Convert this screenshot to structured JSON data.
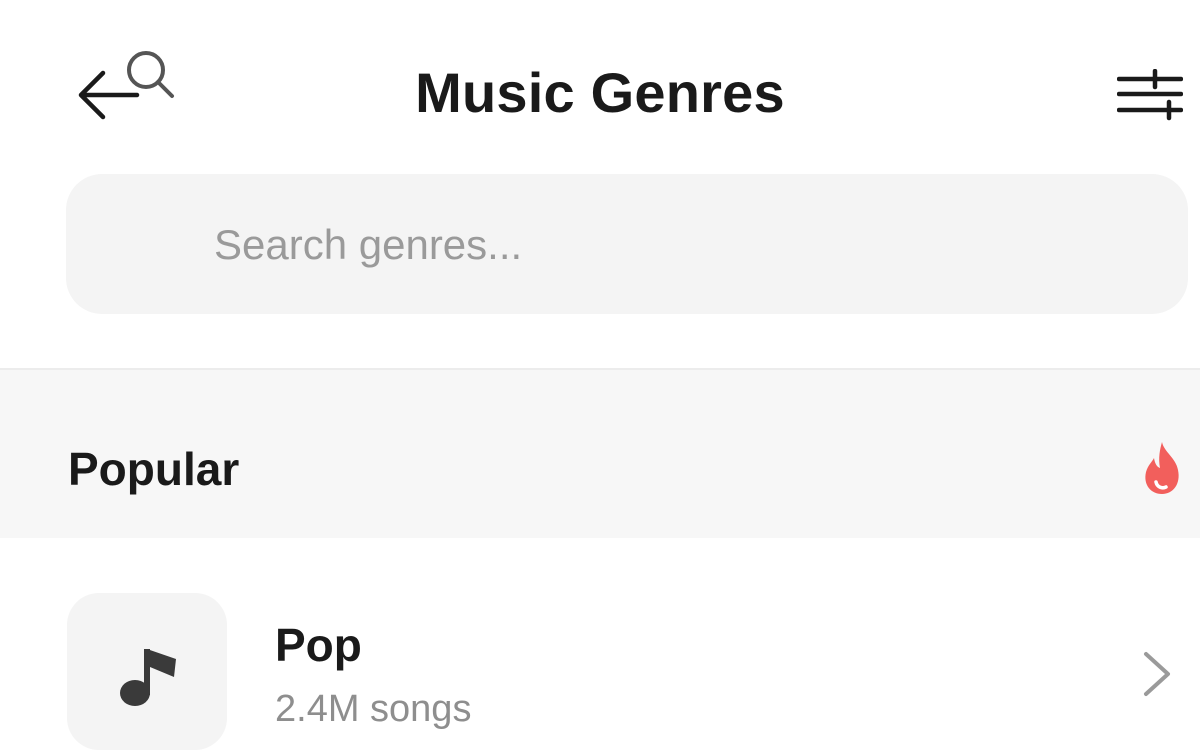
{
  "header": {
    "title": "Music Genres",
    "back_icon": "back-arrow-icon",
    "filter_icon": "filter-sliders-icon"
  },
  "search": {
    "placeholder": "Search genres...",
    "value": "",
    "icon": "search-icon"
  },
  "section": {
    "title": "Popular",
    "icon": "fire-icon",
    "icon_color": "#f25f5c"
  },
  "genres": [
    {
      "name": "Pop",
      "count": "2.4M songs",
      "icon": "music-note-icon"
    }
  ],
  "colors": {
    "text": "#1a1a1a",
    "muted": "#8e8e8e",
    "surface": "#f4f4f4",
    "section_bg": "#f7f7f7",
    "accent": "#f25f5c"
  }
}
